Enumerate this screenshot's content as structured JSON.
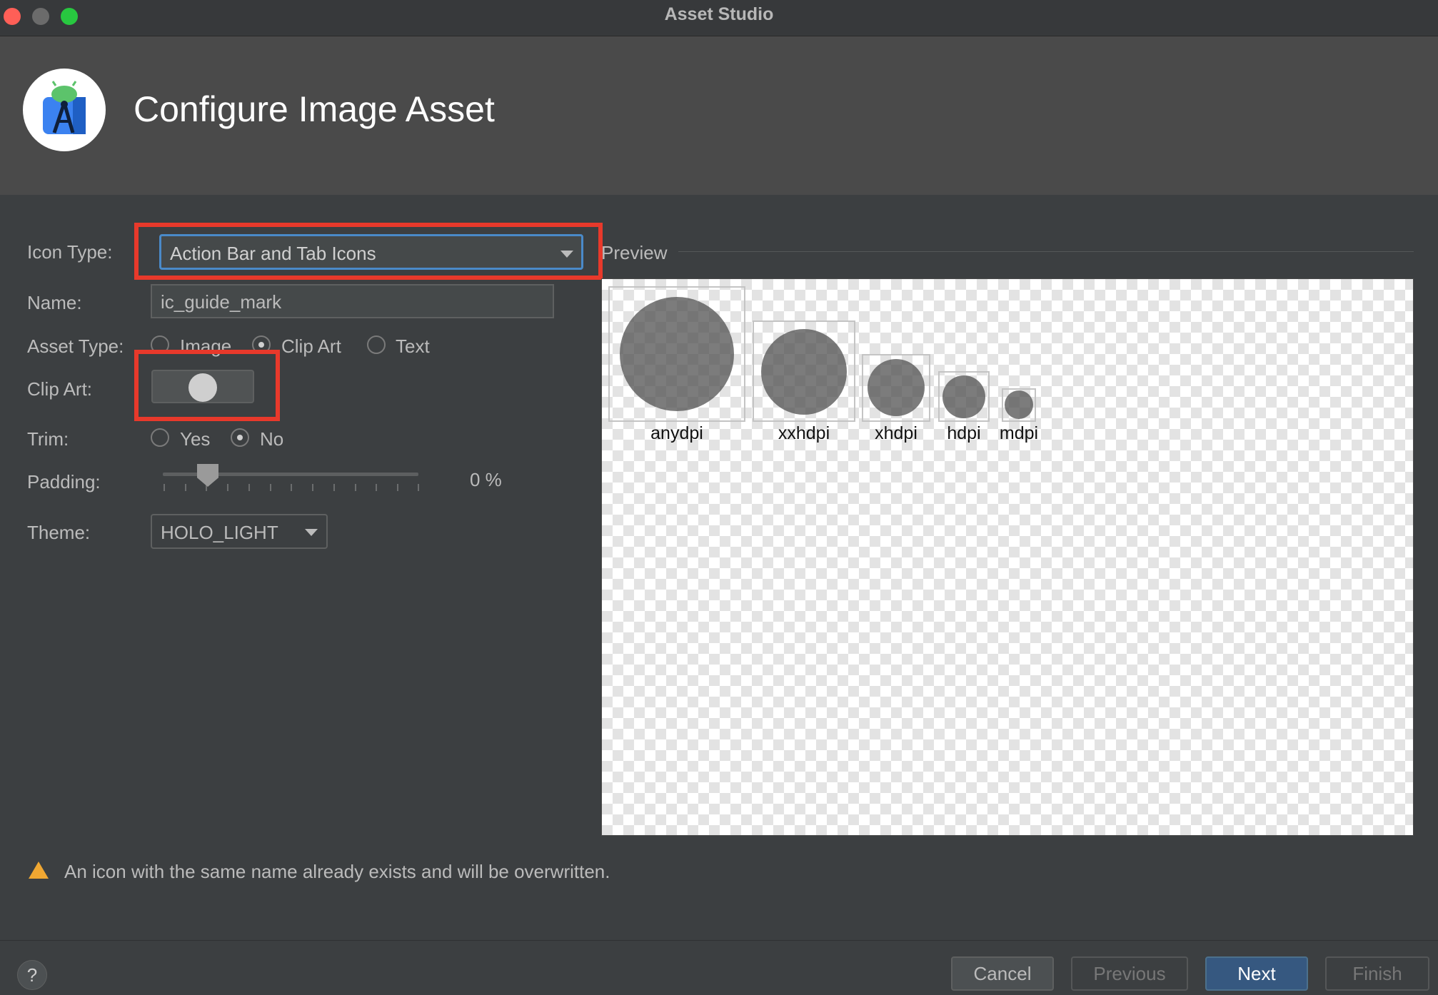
{
  "window": {
    "title": "Asset Studio"
  },
  "header": {
    "title": "Configure Image Asset"
  },
  "form": {
    "icon_type": {
      "label": "Icon Type:",
      "value": "Action Bar and Tab Icons"
    },
    "name": {
      "label": "Name:",
      "value": "ic_guide_mark"
    },
    "asset_type": {
      "label": "Asset Type:",
      "options": [
        "Image",
        "Clip Art",
        "Text"
      ],
      "selected": "Clip Art"
    },
    "clip_art": {
      "label": "Clip Art:"
    },
    "trim": {
      "label": "Trim:",
      "options": [
        "Yes",
        "No"
      ],
      "selected": "No"
    },
    "padding": {
      "label": "Padding:",
      "value": "0 %",
      "level": 0
    },
    "theme": {
      "label": "Theme:",
      "value": "HOLO_LIGHT"
    }
  },
  "preview": {
    "label": "Preview",
    "densities": [
      "anydpi",
      "xxhdpi",
      "xhdpi",
      "hdpi",
      "mdpi"
    ]
  },
  "warning": {
    "text": "An icon with the same name already exists and will be overwritten."
  },
  "buttons": {
    "help": "?",
    "cancel": "Cancel",
    "previous": "Previous",
    "next": "Next",
    "finish": "Finish"
  },
  "colors": {
    "accent": "#365880",
    "highlight": "#e8392b",
    "warning": "#f0a732",
    "focus": "#4a8ac9"
  }
}
